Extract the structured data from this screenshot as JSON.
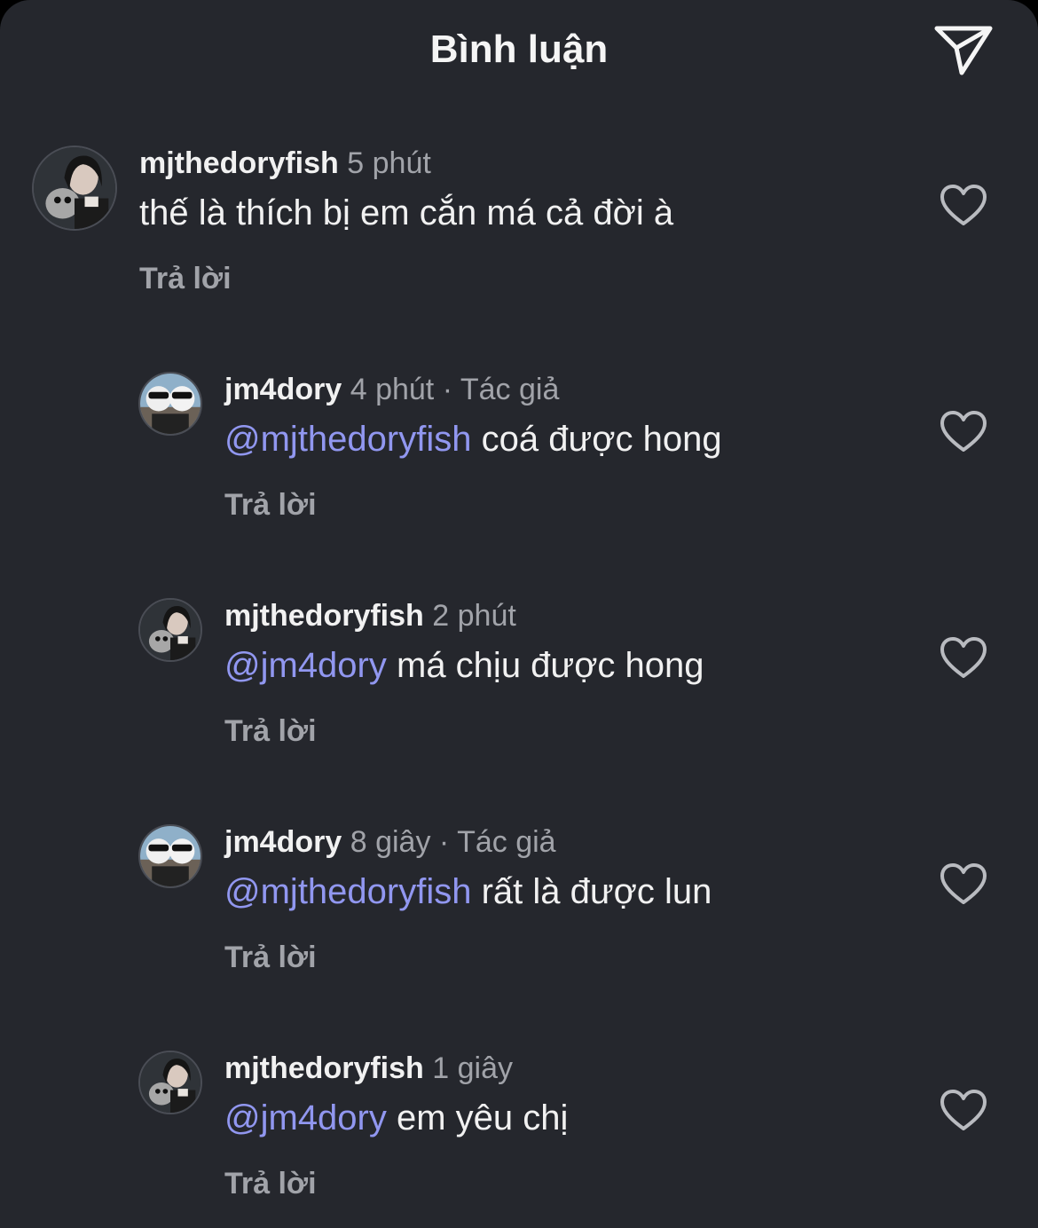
{
  "header": {
    "title": "Bình luận"
  },
  "icons": {
    "share": "send-paper-plane-icon",
    "like": "heart-outline-icon"
  },
  "colors": {
    "background": "#25272d",
    "mention": "#9197f0",
    "secondary_text": "#a1a3a9",
    "primary_text": "#f1f1f1"
  },
  "comments": [
    {
      "username": "mjthedoryfish",
      "time": "5 phút",
      "author_tag": "",
      "mention": "",
      "text": "thế là thích bị em cắn má cả đời à",
      "reply_label": "Trả lời"
    },
    {
      "username": "jm4dory",
      "time": "4 phút",
      "author_tag": "Tác giả",
      "mention": "@mjthedoryfish",
      "text": "coá được hong",
      "reply_label": "Trả lời"
    },
    {
      "username": "mjthedoryfish",
      "time": "2 phút",
      "author_tag": "",
      "mention": "@jm4dory",
      "text": "má chịu được hong",
      "reply_label": "Trả lời"
    },
    {
      "username": "jm4dory",
      "time": "8 giây",
      "author_tag": "Tác giả",
      "mention": "@mjthedoryfish",
      "text": "rất là được lun",
      "reply_label": "Trả lời"
    },
    {
      "username": "mjthedoryfish",
      "time": "1 giây",
      "author_tag": "",
      "mention": "@jm4dory",
      "text": "em yêu chị",
      "reply_label": "Trả lời"
    }
  ]
}
